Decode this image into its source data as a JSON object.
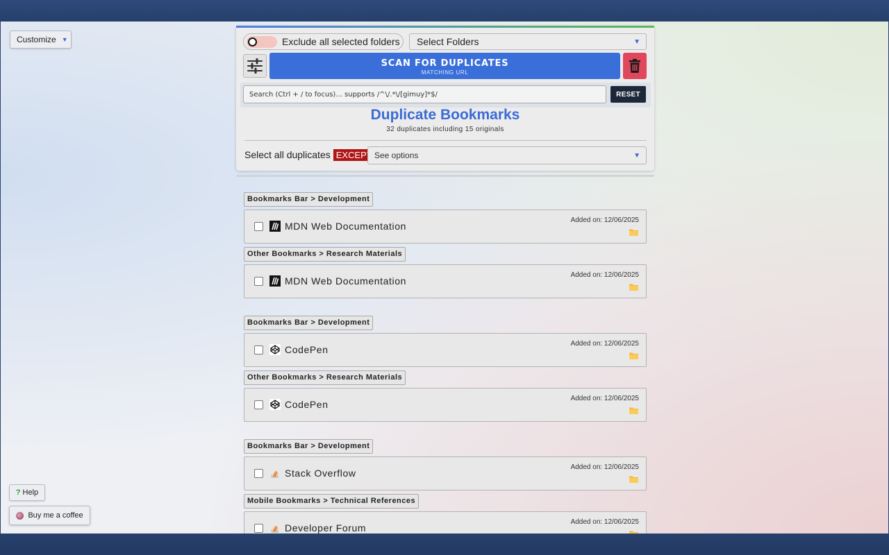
{
  "customize": {
    "label": "Customize"
  },
  "controls": {
    "exclude_label": "Exclude all selected folders",
    "folder_select": "Select Folders",
    "scan_title": "SCAN FOR DUPLICATES",
    "scan_subtitle": "MATCHING URL",
    "search_placeholder": "Search (Ctrl + / to focus)... supports /^\\/.*\\/[gimuy]*$/",
    "reset_label": "RESET"
  },
  "header": {
    "title": "Duplicate Bookmarks",
    "subtitle": "32 duplicates including 15 originals"
  },
  "except": {
    "prefix": "Select all duplicates",
    "badge": "EXCEPT",
    "options": "See options"
  },
  "groups": [
    {
      "entries": [
        {
          "path": "Bookmarks Bar > Development",
          "name": "MDN Web Documentation",
          "date": "Added on: 12/06/2025",
          "icon": "mdn-icon"
        },
        {
          "path": "Other Bookmarks > Research Materials",
          "name": "MDN Web Documentation",
          "date": "Added on: 12/06/2025",
          "icon": "mdn-icon"
        }
      ]
    },
    {
      "entries": [
        {
          "path": "Bookmarks Bar > Development",
          "name": "CodePen",
          "date": "Added on: 12/06/2025",
          "icon": "codepen-icon"
        },
        {
          "path": "Other Bookmarks > Research Materials",
          "name": "CodePen",
          "date": "Added on: 12/06/2025",
          "icon": "codepen-icon"
        }
      ]
    },
    {
      "entries": [
        {
          "path": "Bookmarks Bar > Development",
          "name": "Stack Overflow",
          "date": "Added on: 12/06/2025",
          "icon": "stackoverflow-icon"
        },
        {
          "path": "Mobile Bookmarks > Technical References",
          "name": "Developer Forum",
          "date": "Added on: 12/06/2025",
          "icon": "stackoverflow-icon"
        }
      ]
    }
  ],
  "footer": {
    "help_label": "Help",
    "coffee_label": "Buy me a coffee"
  },
  "colors": {
    "accent": "#3a6fd9",
    "danger": "#e0475c",
    "except": "#b01515",
    "folder": "#f5b942"
  }
}
